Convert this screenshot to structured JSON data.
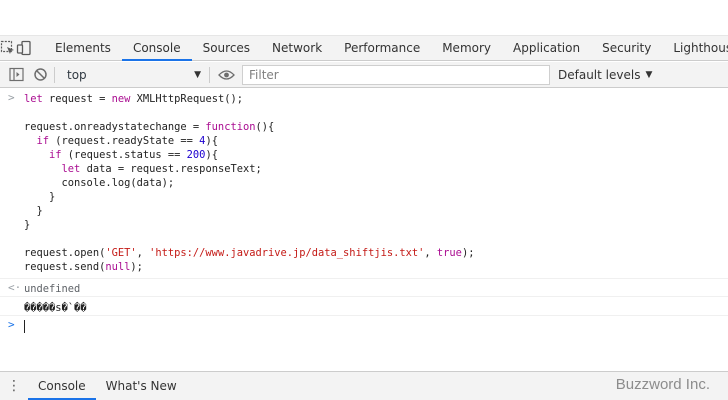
{
  "tabs": [
    {
      "label": "Elements"
    },
    {
      "label": "Console"
    },
    {
      "label": "Sources"
    },
    {
      "label": "Network"
    },
    {
      "label": "Performance"
    },
    {
      "label": "Memory"
    },
    {
      "label": "Application"
    },
    {
      "label": "Security"
    },
    {
      "label": "Lighthouse"
    }
  ],
  "active_tab": "Console",
  "toolbar": {
    "context_value": "top",
    "filter_placeholder": "Filter",
    "levels_label": "Default levels"
  },
  "console": {
    "input_lines": [
      "let request = new XMLHttpRequest();",
      "",
      "request.onreadystatechange = function(){",
      "  if (request.readyState == 4){",
      "    if (request.status == 200){",
      "      let data = request.responseText;",
      "      console.log(data);",
      "    }",
      "  }",
      "}",
      "",
      "request.open('GET', 'https://www.javadrive.jp/data_shiftjis.txt', true);",
      "request.send(null);"
    ],
    "result": "undefined",
    "log_output": "�����s�`��"
  },
  "drawer": {
    "tabs": [
      {
        "label": "Console"
      },
      {
        "label": "What's New"
      }
    ],
    "brand": "Buzzword Inc."
  },
  "icons": {
    "inspect": "inspect-element-icon",
    "device": "device-toolbar-icon",
    "sidebar": "show-sidebar-icon",
    "clear": "clear-console-icon",
    "eye": "live-expression-eye-icon",
    "more": "more-tools-icon"
  },
  "colors": {
    "accent": "#1a73e8",
    "keyword": "#aa0d91",
    "string": "#c41a16",
    "number": "#1c00cf"
  }
}
